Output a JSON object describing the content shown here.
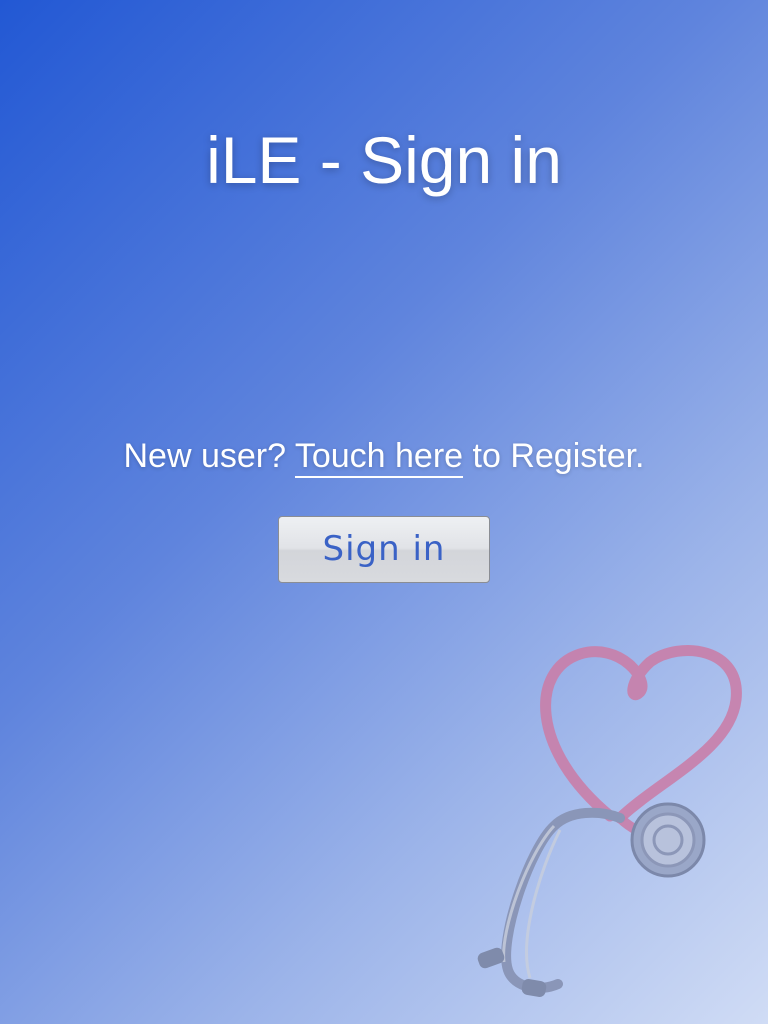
{
  "page": {
    "title": "iLE - Sign in"
  },
  "register": {
    "prefix": "New user?",
    "link_label": "Touch here",
    "suffix": "to Register."
  },
  "signin": {
    "button_label": "Sign in"
  },
  "decor": {
    "image_icon": "stethoscope-heart-icon"
  },
  "colors": {
    "background_top": "#2258d4",
    "background_bottom": "#d0dcf5",
    "button_text": "#3a62c6",
    "heart_tube": "#c97ea8"
  }
}
